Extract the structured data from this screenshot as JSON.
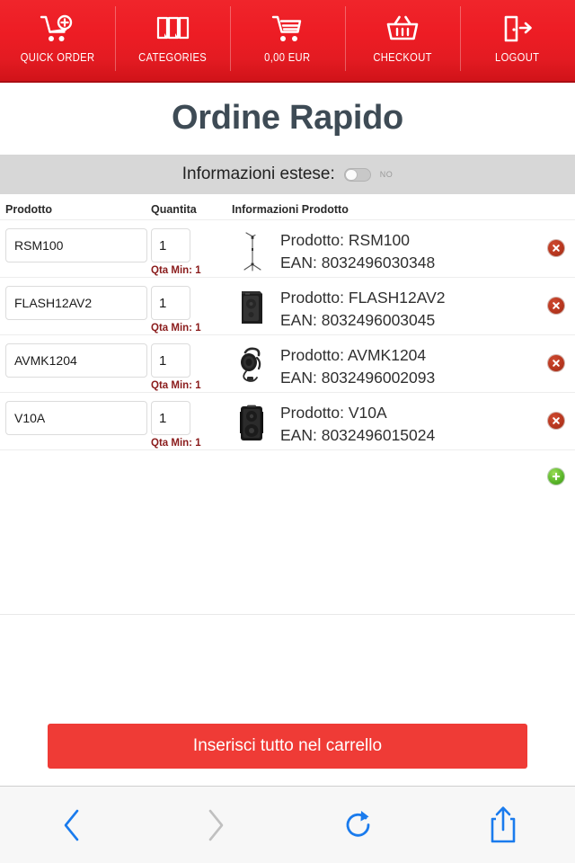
{
  "topnav": {
    "items": [
      {
        "label": "QUICK ORDER",
        "icon": "cart-plus-icon"
      },
      {
        "label": "CATEGORIES",
        "icon": "pages-icon"
      },
      {
        "label": "0,00 EUR",
        "icon": "shopping-cart-icon"
      },
      {
        "label": "CHECKOUT",
        "icon": "basket-icon"
      },
      {
        "label": "LOGOUT",
        "icon": "exit-door-icon"
      }
    ]
  },
  "page": {
    "title": "Ordine Rapido"
  },
  "extended_info": {
    "label": "Informazioni estese:",
    "toggle_state": "NO",
    "toggle_on": false
  },
  "table": {
    "headers": {
      "product": "Prodotto",
      "quantity": "Quantita",
      "info": "Informazioni Prodotto"
    },
    "qty_min_label": "Qta Min: 1",
    "rows": [
      {
        "code": "RSM100",
        "qty": "1",
        "qty_min": "Qta Min: 1",
        "product_line": "Prodotto: RSM100",
        "ean_line": "EAN: 8032496030348",
        "thumb": "mic-stand-thumbnail"
      },
      {
        "code": "FLASH12AV2",
        "qty": "1",
        "qty_min": "Qta Min: 1",
        "product_line": "Prodotto: FLASH12AV2",
        "ean_line": "EAN: 8032496003045",
        "thumb": "speaker-cabinet-thumbnail"
      },
      {
        "code": "AVMK1204",
        "qty": "1",
        "qty_min": "Qta Min: 1",
        "product_line": "Prodotto: AVMK1204",
        "ean_line": "EAN: 8032496002093",
        "thumb": "headset-thumbnail"
      },
      {
        "code": "V10A",
        "qty": "1",
        "qty_min": "Qta Min: 1",
        "product_line": "Prodotto: V10A",
        "ean_line": "EAN: 8032496015024",
        "thumb": "portable-speaker-thumbnail"
      }
    ]
  },
  "cta": {
    "label": "Inserisci tutto nel carrello"
  },
  "bottombar": {
    "buttons": [
      {
        "icon": "back-chevron-icon",
        "enabled": true
      },
      {
        "icon": "forward-chevron-icon",
        "enabled": false
      },
      {
        "icon": "reload-icon",
        "enabled": true
      },
      {
        "icon": "share-icon",
        "enabled": true
      }
    ]
  },
  "colors": {
    "brand_red": "#ed1c24",
    "cta_red": "#ef3b36",
    "title_slate": "#3e4b55",
    "qty_min_red": "#8a1b1b",
    "delete_red": "#b8371f",
    "add_green": "#5cb82b",
    "toolbar_blue": "#1a7bed",
    "toolbar_disabled": "#bfbfbf",
    "ext_bar_grey": "#d7d7d7"
  }
}
